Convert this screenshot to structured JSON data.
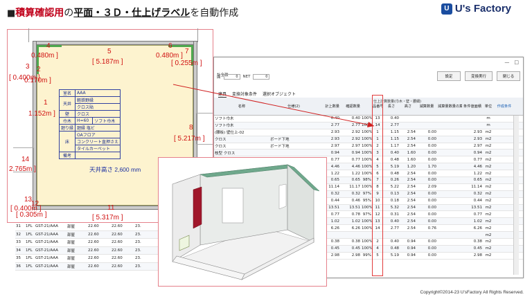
{
  "header": {
    "bullet": "■",
    "part1": "積算確認用",
    "part2": "の",
    "part3": "平面・３Ｄ・仕上げラベル",
    "part4": "を自動作成"
  },
  "logo": {
    "mark": "U",
    "text": "U's Factory"
  },
  "copyright": "Copyright©2014-23 U'sFactory All Rights Reserved.",
  "sheet": {
    "window_buttons": "—　□",
    "small_title": "計全積",
    "label_a": "面",
    "value_a": "0",
    "label_net": "NET",
    "value_net": "0",
    "btn_settings": "設定",
    "btn_change": "変換実行",
    "btn_close": "閉じる",
    "tabs": [
      "建具",
      "変換対象条件",
      "選択オブジェクト"
    ],
    "headers": [
      "名称",
      "仕様(2)",
      "計上数量",
      "確認数量",
      "",
      "品番号",
      "長さ",
      "高さ",
      "減算数量",
      "減算量数量の算出",
      "条件値面積",
      "単位",
      "作成条件"
    ],
    "header_group": "仕上計算数量(巾木・壁・腰細)",
    "rows": [
      {
        "name": "ソフト巾木",
        "spec": "",
        "qty": "0.40",
        "chk": "0.40",
        "pct": "100%",
        "no": "13",
        "len": "0.40",
        "h": "",
        "d": "",
        "area": "",
        "unit": "m"
      },
      {
        "name": "ソフト巾木",
        "spec": "",
        "qty": "2.77",
        "chk": "2.77",
        "pct": "100%",
        "no": "14",
        "len": "2.77",
        "h": "",
        "d": "",
        "area": "",
        "unit": "m"
      },
      {
        "name": "(腰板) 壁仕上-02",
        "spec": "",
        "qty": "2.93",
        "chk": "2.92",
        "pct": "100%",
        "no": "1",
        "len": "1.15",
        "h": "2.54",
        "d": "0.00",
        "area": "2.93",
        "unit": "m2"
      },
      {
        "name": "クロス",
        "spec": "ボード下地",
        "qty": "2.93",
        "chk": "2.92",
        "pct": "100%",
        "no": "1",
        "len": "1.15",
        "h": "2.54",
        "d": "0.00",
        "area": "2.93",
        "unit": "m2"
      },
      {
        "name": "クロス",
        "spec": "ボード下地",
        "qty": "2.97",
        "chk": "2.97",
        "pct": "100%",
        "no": "2",
        "len": "1.17",
        "h": "2.54",
        "d": "0.00",
        "area": "2.97",
        "unit": "m2"
      },
      {
        "name": "枝型 クロス",
        "spec": "",
        "qty": "0.94",
        "chk": "0.94",
        "pct": "100%",
        "no": "3",
        "len": "0.40",
        "h": "1.60",
        "d": "0.00",
        "area": "0.94",
        "unit": "m2"
      },
      {
        "name": "クロス",
        "spec": "ボード下地",
        "qty": "0.77",
        "chk": "0.77",
        "pct": "100%",
        "no": "4",
        "len": "0.48",
        "h": "1.60",
        "d": "0.00",
        "area": "0.77",
        "unit": "m2"
      },
      {
        "name": "クロス",
        "spec": "ボード下地",
        "qty": "4.46",
        "chk": "4.46",
        "pct": "100%",
        "no": "5",
        "len": "5.19",
        "h": "1.20",
        "d": "1.70",
        "area": "4.46",
        "unit": "m2"
      },
      {
        "name": "クロス",
        "spec": "ボード下地",
        "qty": "1.22",
        "chk": "1.22",
        "pct": "100%",
        "no": "6",
        "len": "0.48",
        "h": "2.54",
        "d": "0.00",
        "area": "1.22",
        "unit": "m2"
      },
      {
        "name": "クロス",
        "spec": "ボード下地",
        "qty": "0.65",
        "chk": "0.65",
        "pct": "98%",
        "no": "7",
        "len": "0.26",
        "h": "2.54",
        "d": "0.00",
        "area": "0.65",
        "unit": "m2"
      },
      {
        "name": "クロス",
        "spec": "ボード下地",
        "qty": "11.14",
        "chk": "11.17",
        "pct": "100%",
        "no": "8",
        "len": "5.22",
        "h": "2.54",
        "d": "2.09",
        "area": "11.14",
        "unit": "m2"
      },
      {
        "name": "クロス",
        "spec": "ボード下地",
        "qty": "0.32",
        "chk": "0.32",
        "pct": "97%",
        "no": "9",
        "len": "0.13",
        "h": "2.54",
        "d": "0.00",
        "area": "0.32",
        "unit": "m2"
      },
      {
        "name": "クロス",
        "spec": "ボード下地",
        "qty": "0.44",
        "chk": "0.46",
        "pct": "95%",
        "no": "10",
        "len": "0.18",
        "h": "2.54",
        "d": "0.00",
        "area": "0.44",
        "unit": "m2"
      },
      {
        "name": "クロス",
        "spec": "ボード下地",
        "qty": "13.51",
        "chk": "13.51",
        "pct": "100%",
        "no": "11",
        "len": "5.32",
        "h": "2.54",
        "d": "0.00",
        "area": "13.51",
        "unit": "m2"
      },
      {
        "name": "クロス",
        "spec": "ボード下地",
        "qty": "0.77",
        "chk": "0.78",
        "pct": "97%",
        "no": "12",
        "len": "0.31",
        "h": "2.54",
        "d": "0.00",
        "area": "0.77",
        "unit": "m2"
      },
      {
        "name": "クロス",
        "spec": "ボード下地",
        "qty": "1.02",
        "chk": "1.02",
        "pct": "100%",
        "no": "13",
        "len": "0.40",
        "h": "2.54",
        "d": "0.00",
        "area": "1.02",
        "unit": "m2"
      },
      {
        "name": "クロス",
        "spec": "ボード下地",
        "qty": "6.26",
        "chk": "6.26",
        "pct": "100%",
        "no": "14",
        "len": "2.77",
        "h": "2.54",
        "d": "0.76",
        "area": "6.26",
        "unit": "m2"
      },
      {
        "name": "",
        "spec": "",
        "qty": "",
        "chk": "",
        "pct": "",
        "no": "",
        "len": "",
        "h": "",
        "d": "",
        "area": "",
        "unit": "m2"
      },
      {
        "name": "",
        "spec": "",
        "qty": "0.38",
        "chk": "0.38",
        "pct": "100%",
        "no": "2",
        "len": "0.40",
        "h": "0.94",
        "d": "0.00",
        "area": "0.38",
        "unit": "m2"
      },
      {
        "name": "",
        "spec": "",
        "qty": "0.45",
        "chk": "0.45",
        "pct": "100%",
        "no": "4",
        "len": "0.48",
        "h": "0.94",
        "d": "0.00",
        "area": "0.45",
        "unit": "m2"
      },
      {
        "name": "",
        "spec": "",
        "qty": "2.98",
        "chk": "2.98",
        "pct": "99%",
        "no": "5",
        "len": "5.19",
        "h": "0.94",
        "d": "0.00",
        "area": "2.98",
        "unit": "m2"
      }
    ],
    "left_rows": [
      {
        "no": "31",
        "f": "1FL",
        "g": "GST-21/AAA",
        "r": "部屋",
        "a": "22.60",
        "b": "22.60",
        "c": "23."
      },
      {
        "no": "32",
        "f": "1FL",
        "g": "GST-21/AAA",
        "r": "部屋",
        "a": "22.60",
        "b": "22.60",
        "c": "23."
      },
      {
        "no": "33",
        "f": "1FL",
        "g": "GST-21/AAA",
        "r": "部屋",
        "a": "22.60",
        "b": "22.60",
        "c": "23."
      },
      {
        "no": "34",
        "f": "1FL",
        "g": "GST-21/AAA",
        "r": "部屋",
        "a": "22.60",
        "b": "22.60",
        "c": "23."
      },
      {
        "no": "35",
        "f": "1FL",
        "g": "GST-21/AAA",
        "r": "部屋",
        "a": "22.60",
        "b": "22.60",
        "c": "23."
      },
      {
        "no": "36",
        "f": "1FL",
        "g": "GST-21/AAA",
        "r": "部屋",
        "a": "22.60",
        "b": "22.60",
        "c": "23."
      }
    ]
  },
  "plan": {
    "labels": [
      {
        "n": "4",
        "v": "0.480m ]"
      },
      {
        "n": "5",
        "v": "[ 5.187m ]"
      },
      {
        "n": "6",
        "v": "0.480m ]"
      },
      {
        "n": "7",
        "v": "[ 0.255m ]"
      },
      {
        "n": "3",
        "v": "[ 0.400m ]"
      },
      {
        "n": "2",
        "v": "0.170m ]"
      },
      {
        "n": "1",
        "v": "1.152m ]"
      },
      {
        "n": "8",
        "v": "[ 5.217m ]"
      },
      {
        "n": "14",
        "v": "2.765m ]"
      },
      {
        "n": "13",
        "v": "[ 0.400m ]"
      },
      {
        "n": "12",
        "v": "[ 0.305m ]"
      },
      {
        "n": "11",
        "v": "[ 5.317m ]"
      }
    ],
    "room_table": {
      "room_h": "室名",
      "room": "AAA",
      "ceil_h": "天井",
      "ceil1": "軽鉄野縁",
      "ceil2": "クロス貼",
      "wall_h": "壁",
      "wall": "クロス",
      "base_h": "巾木",
      "base1": "H=60",
      "base2": "ソフト巾木",
      "edge_h": "廻り縁",
      "edge": "廻縁 塩ビ",
      "floor_h": "床",
      "floor1": "OAフロア",
      "floor2": "コンクリート直押さえ",
      "floor3": "タイルカーペット",
      "note_h": "備考",
      "note": ""
    },
    "ceiling_height": "天井高さ 2,600 mm"
  }
}
